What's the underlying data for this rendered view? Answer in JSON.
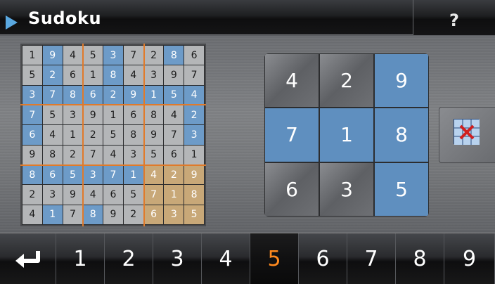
{
  "title": "Sudoku",
  "help_label": "?",
  "mini_grid": {
    "rows": [
      [
        "1",
        "9",
        "4",
        "5",
        "3",
        "7",
        "2",
        "8",
        "6"
      ],
      [
        "5",
        "2",
        "6",
        "1",
        "8",
        "4",
        "3",
        "9",
        "7"
      ],
      [
        "3",
        "7",
        "8",
        "6",
        "2",
        "9",
        "1",
        "5",
        "4"
      ],
      [
        "7",
        "5",
        "3",
        "9",
        "1",
        "6",
        "8",
        "4",
        "2"
      ],
      [
        "6",
        "4",
        "1",
        "2",
        "5",
        "8",
        "9",
        "7",
        "3"
      ],
      [
        "9",
        "8",
        "2",
        "7",
        "4",
        "3",
        "5",
        "6",
        "1"
      ],
      [
        "8",
        "6",
        "5",
        "3",
        "7",
        "1",
        "4",
        "2",
        "9"
      ],
      [
        "2",
        "3",
        "9",
        "4",
        "6",
        "5",
        "7",
        "1",
        "8"
      ],
      [
        "4",
        "1",
        "7",
        "8",
        "9",
        "2",
        "6",
        "3",
        "5"
      ]
    ],
    "highlight": [
      [
        "g",
        "b",
        "g",
        "g",
        "b",
        "g",
        "g",
        "b",
        "g"
      ],
      [
        "g",
        "b",
        "g",
        "g",
        "b",
        "g",
        "g",
        "g",
        "g"
      ],
      [
        "b",
        "b",
        "b",
        "b",
        "b",
        "b",
        "b",
        "b",
        "b"
      ],
      [
        "b",
        "g",
        "g",
        "g",
        "g",
        "g",
        "g",
        "g",
        "b"
      ],
      [
        "b",
        "g",
        "g",
        "g",
        "g",
        "g",
        "g",
        "g",
        "b"
      ],
      [
        "g",
        "g",
        "g",
        "g",
        "g",
        "g",
        "g",
        "g",
        "g"
      ],
      [
        "b",
        "b",
        "b",
        "b",
        "b",
        "b",
        "o",
        "o",
        "o"
      ],
      [
        "g",
        "g",
        "g",
        "g",
        "g",
        "g",
        "o",
        "o",
        "o"
      ],
      [
        "g",
        "b",
        "g",
        "b",
        "g",
        "g",
        "o",
        "o",
        "o"
      ]
    ]
  },
  "big_block": {
    "cells": [
      "4",
      "2",
      "9",
      "7",
      "1",
      "8",
      "6",
      "3",
      "5"
    ],
    "blue": [
      false,
      false,
      true,
      true,
      true,
      true,
      false,
      false,
      true
    ]
  },
  "clear_icon": "clear-cell-icon",
  "bottom_bar": {
    "back_icon": "return-arrow-icon",
    "digits": [
      "1",
      "2",
      "3",
      "4",
      "5",
      "6",
      "7",
      "8",
      "9"
    ],
    "selected": "5"
  },
  "colors": {
    "accent_blue": "#5f8fbf",
    "selected_digit": "#ff8a1e",
    "orange_highlight": "#c8a878"
  }
}
